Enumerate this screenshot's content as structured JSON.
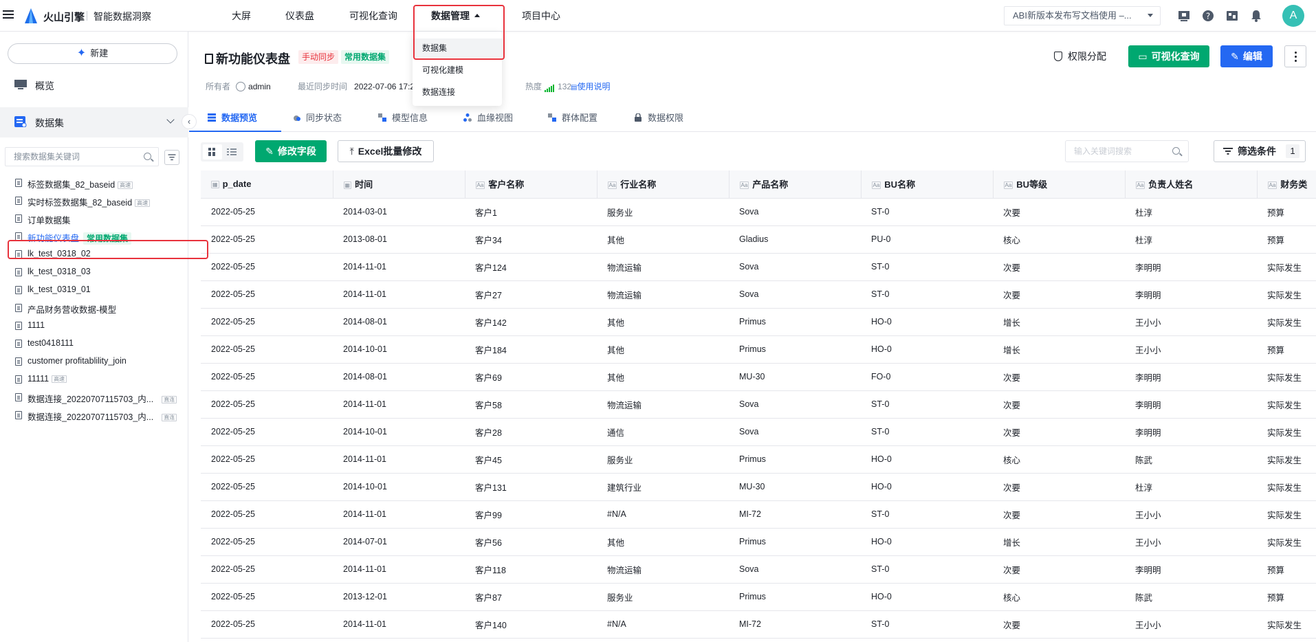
{
  "topbar": {
    "brand": "火山引擎",
    "product": "智能数据洞察",
    "nav": [
      {
        "label": "大屏",
        "active": false
      },
      {
        "label": "仪表盘",
        "active": false
      },
      {
        "label": "可视化查询",
        "active": false
      },
      {
        "label": "数据管理",
        "active": true
      },
      {
        "label": "项目中心",
        "active": false
      }
    ],
    "notice": "ABI新版本发布写文档使用 –...",
    "avatar_letter": "A"
  },
  "dropdown": {
    "items": [
      "数据集",
      "可视化建模",
      "数据连接"
    ]
  },
  "sidebar": {
    "new_button": "新建",
    "overview": "概览",
    "datasets_section": "数据集",
    "search_placeholder": "搜索数据集关键词",
    "items": [
      {
        "name": "标签数据集_82_baseid",
        "mini_tag": "高速",
        "active": false
      },
      {
        "name": "实时标签数据集_82_baseid",
        "mini_tag": "高速",
        "active": false
      },
      {
        "name": "订单数据集",
        "mini_tag": "",
        "active": false
      },
      {
        "name": "新功能仪表盘",
        "tag": "常用数据集",
        "active": true
      },
      {
        "name": "lk_test_0318_02",
        "mini_tag": "",
        "active": false
      },
      {
        "name": "lk_test_0318_03",
        "mini_tag": "",
        "active": false
      },
      {
        "name": "lk_test_0319_01",
        "mini_tag": "",
        "active": false
      },
      {
        "name": "产品财务营收数据-模型",
        "mini_tag": "",
        "active": false
      },
      {
        "name": "1111",
        "mini_tag": "",
        "active": false
      },
      {
        "name": "test0418111",
        "mini_tag": "",
        "active": false
      },
      {
        "name": "customer profitablility_join",
        "mini_tag": "",
        "active": false
      },
      {
        "name": "11111",
        "mini_tag": "高速",
        "active": false
      },
      {
        "name": "数据连接_20220707115703_内...",
        "mini_tag": "直连",
        "active": false
      },
      {
        "name": "数据连接_20220707115703_内...",
        "mini_tag": "直连",
        "active": false
      }
    ]
  },
  "header": {
    "title": "新功能仪表盘",
    "tag_sync": "手动同步",
    "tag_common": "常用数据集",
    "owner_label": "所有者",
    "owner": "admin",
    "sync_label": "最近同步时间",
    "sync_time": "2022-07-06 17:2",
    "heat_label": "热度",
    "heat_value": "132",
    "help_link": "使用说明",
    "perm_button": "权限分配",
    "query_button": "可视化查询",
    "edit_button": "编辑"
  },
  "tabs": [
    {
      "label": "数据预览",
      "active": true
    },
    {
      "label": "同步状态",
      "active": false
    },
    {
      "label": "模型信息",
      "active": false
    },
    {
      "label": "血缘视图",
      "active": false
    },
    {
      "label": "群体配置",
      "active": false
    },
    {
      "label": "数据权限",
      "active": false
    }
  ],
  "toolbar": {
    "edit_fields": "修改字段",
    "excel_edit": "Excel批量修改",
    "search_placeholder": "输入关键词搜索",
    "filter_label": "筛选条件",
    "filter_count": "1"
  },
  "table": {
    "columns": [
      {
        "label": "p_date",
        "type": "日期"
      },
      {
        "label": "时间",
        "type": "日期"
      },
      {
        "label": "客户名称",
        "type": "Aa"
      },
      {
        "label": "行业名称",
        "type": "Aa"
      },
      {
        "label": "产品名称",
        "type": "Aa"
      },
      {
        "label": "BU名称",
        "type": "Aa"
      },
      {
        "label": "BU等级",
        "type": "Aa"
      },
      {
        "label": "负责人姓名",
        "type": "Aa"
      },
      {
        "label": "财务类",
        "type": "Aa"
      }
    ],
    "rows": [
      [
        "2022-05-25",
        "2014-03-01",
        "客户1",
        "服务业",
        "Sova",
        "ST-0",
        "次要",
        "杜淳",
        "预算"
      ],
      [
        "2022-05-25",
        "2013-08-01",
        "客户34",
        "其他",
        "Gladius",
        "PU-0",
        "核心",
        "杜淳",
        "预算"
      ],
      [
        "2022-05-25",
        "2014-11-01",
        "客户124",
        "物流运输",
        "Sova",
        "ST-0",
        "次要",
        "李明明",
        "实际发生"
      ],
      [
        "2022-05-25",
        "2014-11-01",
        "客户27",
        "物流运输",
        "Sova",
        "ST-0",
        "次要",
        "李明明",
        "实际发生"
      ],
      [
        "2022-05-25",
        "2014-08-01",
        "客户142",
        "其他",
        "Primus",
        "HO-0",
        "增长",
        "王小小",
        "实际发生"
      ],
      [
        "2022-05-25",
        "2014-10-01",
        "客户184",
        "其他",
        "Primus",
        "HO-0",
        "增长",
        "王小小",
        "预算"
      ],
      [
        "2022-05-25",
        "2014-08-01",
        "客户69",
        "其他",
        "MU-30",
        "FO-0",
        "次要",
        "李明明",
        "实际发生"
      ],
      [
        "2022-05-25",
        "2014-11-01",
        "客户58",
        "物流运输",
        "Sova",
        "ST-0",
        "次要",
        "李明明",
        "实际发生"
      ],
      [
        "2022-05-25",
        "2014-10-01",
        "客户28",
        "通信",
        "Sova",
        "ST-0",
        "次要",
        "李明明",
        "实际发生"
      ],
      [
        "2022-05-25",
        "2014-11-01",
        "客户45",
        "服务业",
        "Primus",
        "HO-0",
        "核心",
        "陈武",
        "实际发生"
      ],
      [
        "2022-05-25",
        "2014-10-01",
        "客户131",
        "建筑行业",
        "MU-30",
        "HO-0",
        "次要",
        "杜淳",
        "实际发生"
      ],
      [
        "2022-05-25",
        "2014-11-01",
        "客户99",
        "#N/A",
        "MI-72",
        "ST-0",
        "次要",
        "王小小",
        "实际发生"
      ],
      [
        "2022-05-25",
        "2014-07-01",
        "客户56",
        "其他",
        "Primus",
        "HO-0",
        "增长",
        "王小小",
        "实际发生"
      ],
      [
        "2022-05-25",
        "2014-11-01",
        "客户118",
        "物流运输",
        "Sova",
        "ST-0",
        "次要",
        "李明明",
        "预算"
      ],
      [
        "2022-05-25",
        "2013-12-01",
        "客户87",
        "服务业",
        "Primus",
        "HO-0",
        "核心",
        "陈武",
        "预算"
      ],
      [
        "2022-05-25",
        "2014-11-01",
        "客户140",
        "#N/A",
        "MI-72",
        "ST-0",
        "次要",
        "王小小",
        "实际发生"
      ]
    ]
  },
  "colors": {
    "accent_blue": "#2468f2",
    "green": "#00a870",
    "red": "#e8323c",
    "highlight_box": "#e8323c"
  }
}
